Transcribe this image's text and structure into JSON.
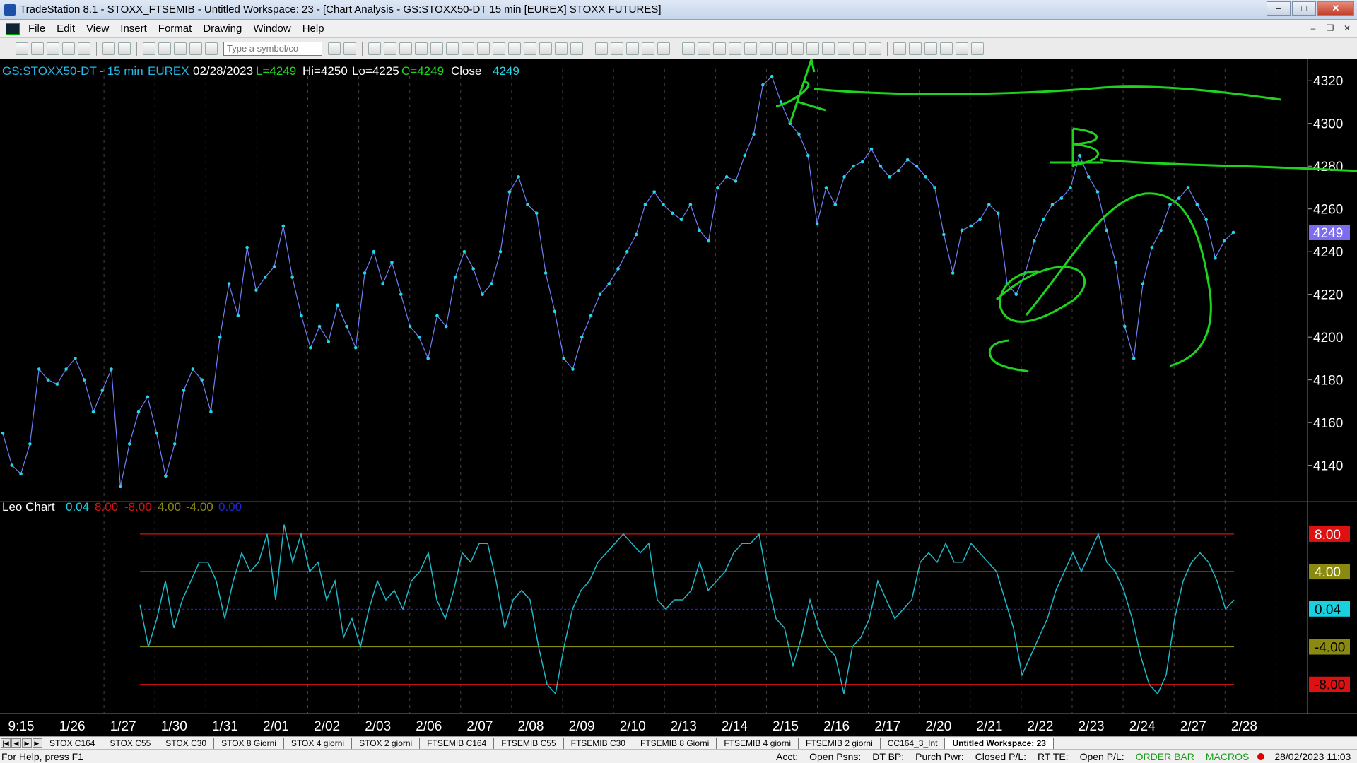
{
  "window": {
    "title": "TradeStation 8.1 - STOXX_FTSEMIB - Untitled Workspace:  23 - [Chart Analysis - GS:STOXX50-DT  15 min  [EUREX] STOXX FUTURES]"
  },
  "menu": [
    "File",
    "Edit",
    "View",
    "Insert",
    "Format",
    "Drawing",
    "Window",
    "Help"
  ],
  "toolbar": {
    "symbol_placeholder": "Type a symbol/co"
  },
  "header": {
    "symbol": "GS:STOXX50-DT - 15 min",
    "exchange": "EUREX",
    "date": "02/28/2023",
    "last": "L=4249",
    "hi": "Hi=4250",
    "lo": "Lo=4225",
    "close_label_c": "C=4249",
    "close_word": "Close",
    "close_value": "4249"
  },
  "indicator": {
    "name": "Leo Chart",
    "v1": "0.04",
    "v2": "8.00",
    "v3": "-8.00",
    "v4": "4.00",
    "v5": "-4.00",
    "v6": "0.00"
  },
  "price_axis": {
    "labels": [
      "4320",
      "4300",
      "4280",
      "4260",
      "4240",
      "4220",
      "4200",
      "4180",
      "4160",
      "4140"
    ],
    "current": "4249"
  },
  "osc_axis": {
    "labels": [
      "8.00",
      "4.00",
      "0.04",
      "-4.00",
      "-8.00"
    ]
  },
  "annotations": [
    "A",
    "B",
    "C"
  ],
  "chart_data": {
    "type": "line",
    "title": "GS:STOXX50-DT - 15 min",
    "x_tick_labels": [
      "9:15",
      "1/26",
      "1/27",
      "1/30",
      "1/31",
      "2/01",
      "2/02",
      "2/03",
      "2/06",
      "2/07",
      "2/08",
      "2/09",
      "2/10",
      "2/13",
      "2/14",
      "2/15",
      "2/16",
      "2/17",
      "2/20",
      "2/21",
      "2/22",
      "2/23",
      "2/24",
      "2/27",
      "2/28"
    ],
    "ylim": [
      4125,
      4330
    ],
    "osc_ylim": [
      -10.5,
      11
    ],
    "grid": "vertical dashed per day",
    "series": [
      {
        "name": "Close",
        "color": "#22d8e8",
        "values": [
          4155,
          4140,
          4136,
          4150,
          4185,
          4180,
          4178,
          4185,
          4190,
          4180,
          4165,
          4175,
          4185,
          4130,
          4150,
          4165,
          4172,
          4155,
          4135,
          4150,
          4175,
          4185,
          4180,
          4165,
          4200,
          4225,
          4210,
          4242,
          4222,
          4228,
          4233,
          4252,
          4228,
          4210,
          4195,
          4205,
          4198,
          4215,
          4205,
          4195,
          4230,
          4240,
          4225,
          4235,
          4220,
          4205,
          4200,
          4190,
          4210,
          4205,
          4228,
          4240,
          4232,
          4220,
          4225,
          4240,
          4268,
          4275,
          4262,
          4258,
          4230,
          4212,
          4190,
          4185,
          4200,
          4210,
          4220,
          4225,
          4232,
          4240,
          4248,
          4262,
          4268,
          4262,
          4258,
          4255,
          4262,
          4250,
          4245,
          4270,
          4275,
          4273,
          4285,
          4295,
          4318,
          4322,
          4310,
          4300,
          4295,
          4285,
          4253,
          4270,
          4262,
          4275,
          4280,
          4282,
          4288,
          4280,
          4275,
          4278,
          4283,
          4280,
          4275,
          4270,
          4248,
          4230,
          4250,
          4252,
          4255,
          4262,
          4258,
          4225,
          4220,
          4230,
          4245,
          4255,
          4262,
          4265,
          4270,
          4285,
          4275,
          4268,
          4250,
          4235,
          4205,
          4190,
          4225,
          4242,
          4250,
          4262,
          4265,
          4270,
          4262,
          4255,
          4237,
          4245,
          4249
        ]
      },
      {
        "name": "Leo Chart",
        "color": "#1fb8c8",
        "values": [
          0.5,
          -4,
          -1,
          3,
          -2,
          1,
          3,
          5,
          5,
          3,
          -1,
          3,
          6,
          4,
          5,
          8,
          1,
          9,
          5,
          8,
          4,
          5,
          1,
          3,
          -3,
          -1,
          -4,
          0,
          3,
          1,
          2,
          0,
          3,
          4,
          6,
          1,
          -1,
          2,
          6,
          5,
          7,
          7,
          3,
          -2,
          1,
          2,
          1,
          -4,
          -8,
          -9,
          -4,
          0,
          2,
          3,
          5,
          6,
          7,
          8,
          7,
          6,
          7,
          1,
          0,
          1,
          1,
          2,
          5,
          2,
          3,
          4,
          6,
          7,
          7,
          8,
          3,
          -1,
          -2,
          -6,
          -3,
          1,
          -2,
          -4,
          -5,
          -9,
          -4,
          -3,
          -1,
          3,
          1,
          -1,
          0,
          1,
          5,
          6,
          5,
          7,
          5,
          5,
          7,
          6,
          5,
          4,
          1,
          -2,
          -7,
          -5,
          -3,
          -1,
          2,
          4,
          6,
          4,
          6,
          8,
          5,
          4,
          2,
          -1,
          -5,
          -8,
          -9,
          -7,
          -1,
          3,
          5,
          6,
          5,
          3,
          0,
          1
        ]
      }
    ]
  }
}
